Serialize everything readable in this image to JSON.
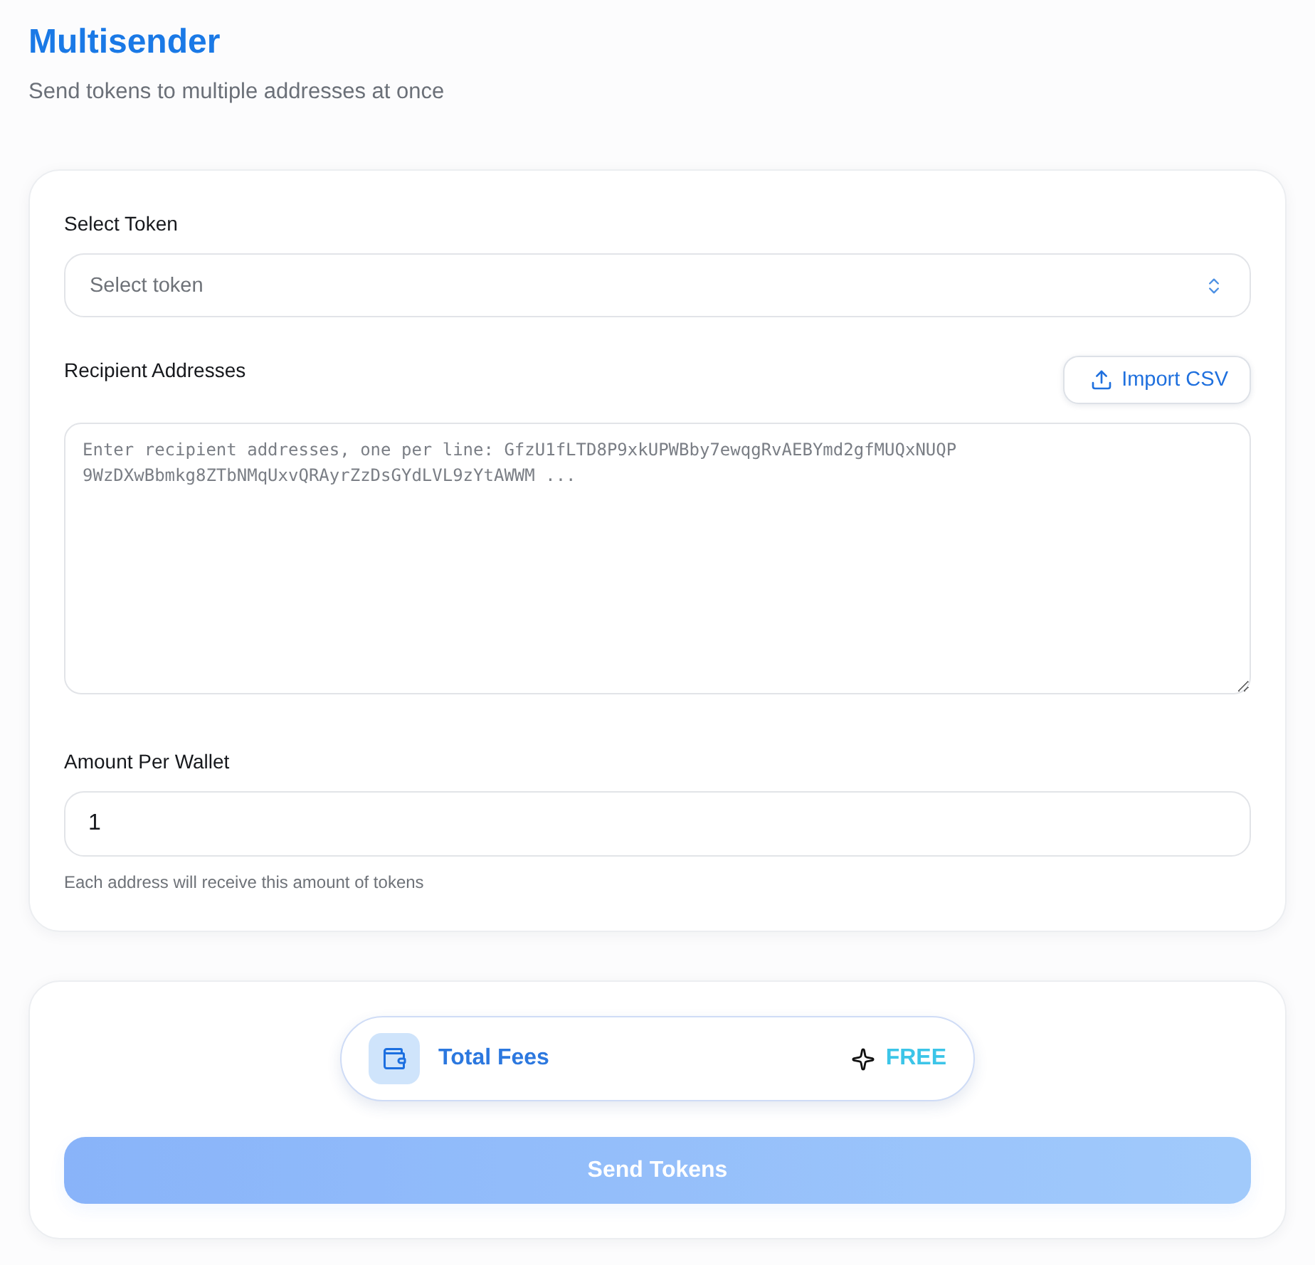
{
  "header": {
    "title": "Multisender",
    "subtitle": "Send tokens to multiple addresses at once"
  },
  "form": {
    "token_select": {
      "label": "Select Token",
      "placeholder": "Select token"
    },
    "recipients": {
      "label": "Recipient Addresses",
      "import_button": "Import CSV",
      "placeholder": "Enter recipient addresses, one per line: GfzU1fLTD8P9xkUPWBby7ewqgRvAEBYmd2gfMUQxNUQP\n9WzDXwBbmkg8ZTbNMqUxvQRAyrZzDsGYdLVL9zYtAWWM ..."
    },
    "amount": {
      "label": "Amount Per Wallet",
      "value": "1",
      "help": "Each address will receive this amount of tokens"
    }
  },
  "summary": {
    "fees": {
      "label": "Total Fees",
      "value": "FREE"
    },
    "send_button": {
      "label": "Send Tokens",
      "disabled": true
    }
  }
}
